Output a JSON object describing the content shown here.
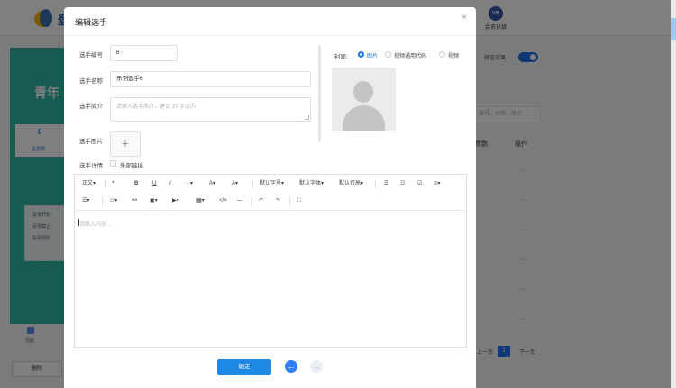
{
  "background": {
    "vip_label": "会员升级",
    "vip_badge": "VIP",
    "banner_title": "青年",
    "stat_value": "0",
    "stat_label": "总票数",
    "info_lines": [
      "投票开始:",
      "投票截止:",
      "投票规则:"
    ],
    "nav_label": "功能",
    "delete_button": "删除",
    "toggle_label": "预览效果",
    "search_placeholder": "编号、名称、简介",
    "column_headers": [
      "票数",
      "操作"
    ],
    "row_action": "···",
    "pager": {
      "prev": "上一页",
      "current": "1",
      "next": "下一页"
    }
  },
  "modal": {
    "title": "编辑选手",
    "close_glyph": "×",
    "form": {
      "number_label": "选手编号",
      "number_value": "6",
      "name_label": "选手名称",
      "name_value": "示例选手6",
      "intro_label": "选手简介",
      "intro_placeholder": "请输入选手简介，建议 15 字以内",
      "image_label": "选手图片",
      "upload_glyph": "+",
      "detail_label": "选手详情",
      "external_link_label": "外部链接"
    },
    "cover": {
      "label": "封面:",
      "options": [
        "图片",
        "视频通用代码",
        "视频"
      ],
      "selected": "图片"
    },
    "editor": {
      "toolbar_row1": [
        "正文▾",
        "❝",
        "B",
        "U",
        "I",
        "···▾",
        "A▾",
        "A▾",
        "默认字号▾",
        "默认字体▾",
        "默认行高▾",
        "☰",
        "☷",
        "☑",
        "≡▾"
      ],
      "toolbar_row2": [
        "☰▾",
        "☺▾",
        "⚯",
        "▣▾",
        "▶▾",
        "▦▾",
        "</>",
        "—",
        "↶",
        "↷",
        "⛶"
      ],
      "placeholder": "请输入内容..."
    },
    "confirm_button": "确定",
    "prev_glyph": "←",
    "next_glyph": "→"
  }
}
